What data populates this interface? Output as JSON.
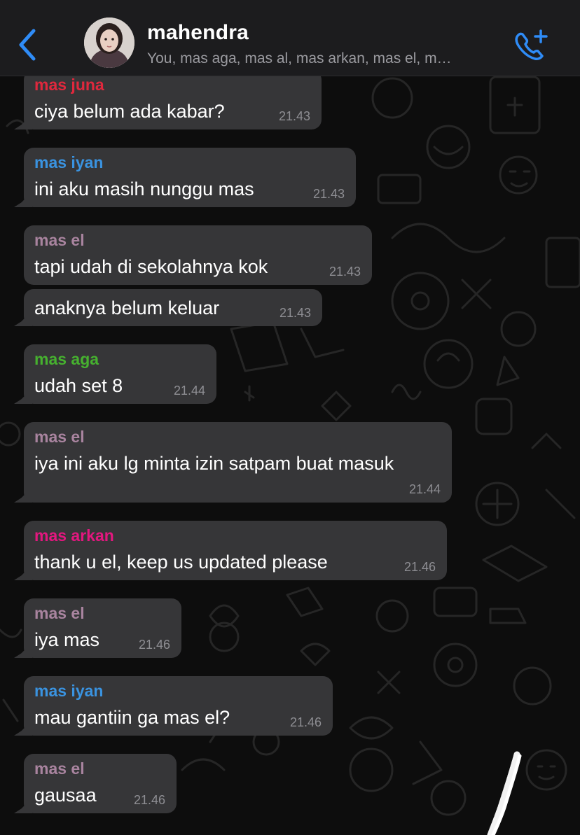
{
  "header": {
    "back_icon": "chevron-left-icon",
    "title": "mahendra",
    "subtitle": "You, mas aga, mas al, mas arkan, mas el, m…",
    "call_icon": "phone-add-icon",
    "accent_color": "#2f8cf7"
  },
  "messages": [
    {
      "sender": "mas juna",
      "sender_color": "#e0283d",
      "text": "ciya belum ada kabar?",
      "time": "21.43"
    },
    {
      "sender": "mas iyan",
      "sender_color": "#3a93e0",
      "text": "ini aku masih nunggu mas",
      "time": "21.43"
    },
    {
      "sender": "mas el",
      "sender_color": "#a9849f",
      "text": "tapi udah di sekolahnya kok",
      "time": "21.43"
    },
    {
      "sender": "",
      "sender_color": "",
      "text": "anaknya belum keluar",
      "time": "21.43"
    },
    {
      "sender": "mas aga",
      "sender_color": "#46b12f",
      "text": "udah set 8",
      "time": "21.44"
    },
    {
      "sender": "mas el",
      "sender_color": "#a9849f",
      "text": "iya ini aku lg minta izin satpam buat masuk",
      "time": "21.44"
    },
    {
      "sender": "mas arkan",
      "sender_color": "#e3177f",
      "text": "thank u el, keep us updated please",
      "time": "21.46"
    },
    {
      "sender": "mas el",
      "sender_color": "#a9849f",
      "text": "iya mas",
      "time": "21.46"
    },
    {
      "sender": "mas iyan",
      "sender_color": "#3a93e0",
      "text": "mau gantiin ga mas el?",
      "time": "21.46"
    },
    {
      "sender": "mas el",
      "sender_color": "#a9849f",
      "text": "gausaa",
      "time": "21.46"
    }
  ]
}
